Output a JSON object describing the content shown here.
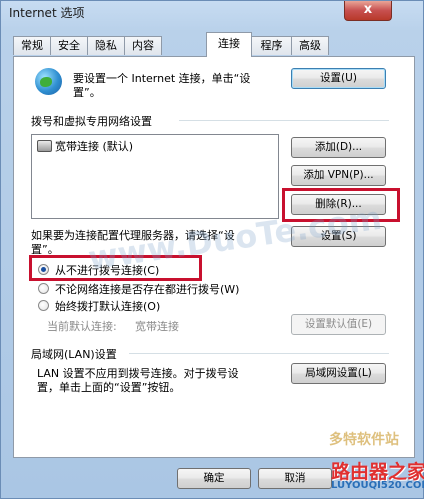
{
  "window": {
    "title": "Internet 选项",
    "close_label": "x"
  },
  "tabs": [
    "常规",
    "安全",
    "隐私",
    "内容",
    "连接",
    "程序",
    "高级"
  ],
  "active_tab": "连接",
  "setup": {
    "text_line1": "要设置一个 Internet 连接，单击“设",
    "text_line2": "置”。",
    "button": "设置(U)"
  },
  "dialup": {
    "section_title": "拨号和虚拟专用网络设置",
    "connections": [
      "宽带连接 (默认)"
    ],
    "add_button": "添加(D)...",
    "add_vpn_button": "添加 VPN(P)...",
    "delete_button": "删除(R)...",
    "proxy_text_line1": "如果要为连接配置代理服务器，请选择“设",
    "proxy_text_line2": "置”。",
    "settings_button": "设置(S)",
    "options": [
      "从不进行拨号连接(C)",
      "不论网络连接是否存在都进行拨号(W)",
      "始终拨打默认连接(O)"
    ],
    "selected_option": 0,
    "current_default_label": "当前默认连接:",
    "current_default_value": "宽带连接",
    "set_default_button": "设置默认值(E)"
  },
  "lan": {
    "section_title": "局域网(LAN)设置",
    "text_line1": "LAN 设置不应用到拨号连接。对于拨号设",
    "text_line2": "置，单击上面的“设置”按钮。",
    "button": "局域网设置(L)"
  },
  "footer": {
    "ok_button": "确定",
    "cancel_button": "取消"
  },
  "watermarks": {
    "main": "www.DuoTe.com",
    "badge_text": "多特软件站",
    "router_text": "路由器之家",
    "router_url": "LUYOUQI520.COM"
  },
  "colors": {
    "highlight": "#c8102e",
    "accent": "#3c7fb1"
  }
}
